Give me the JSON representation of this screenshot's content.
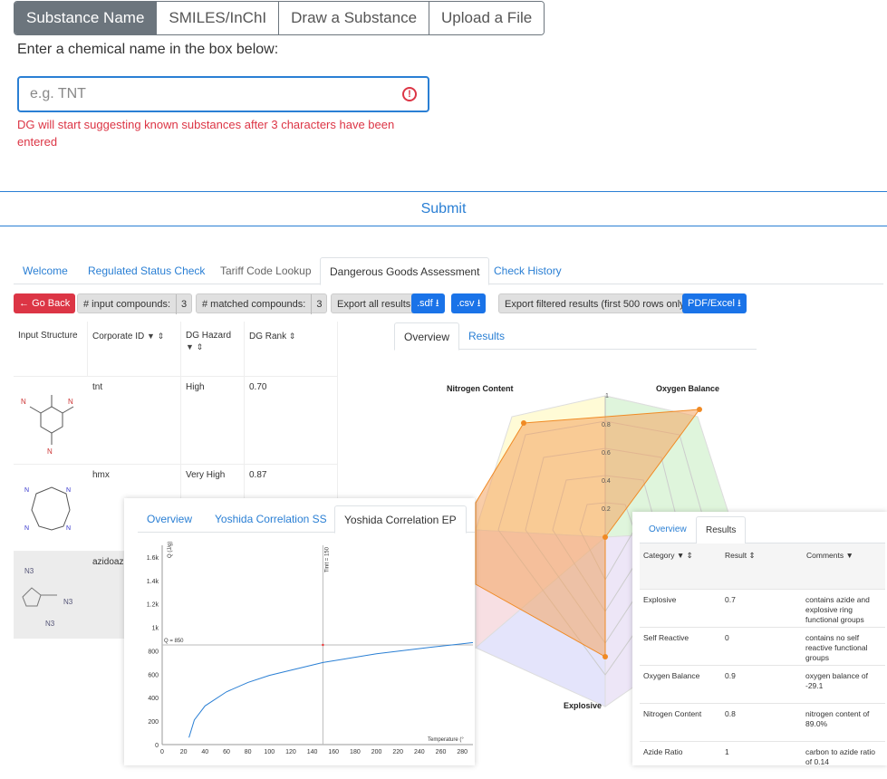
{
  "search_tabs": [
    "Substance Name",
    "SMILES/InChI",
    "Draw a Substance",
    "Upload a File"
  ],
  "prompt": "Enter a chemical name in the box below:",
  "input": {
    "placeholder": "e.g. TNT",
    "value": ""
  },
  "error_message": "DG will start suggesting known substances after 3 characters have been entered",
  "submit_label": "Submit",
  "nav_tabs": [
    "Welcome",
    "Regulated Status Check",
    "Tariff Code Lookup",
    "Dangerous Goods Assessment",
    "Check History"
  ],
  "toolbar": {
    "go_back": "Go Back",
    "input_compounds_label": "# input compounds:",
    "input_compounds_count": "3",
    "matched_compounds_label": "# matched compounds:",
    "matched_compounds_count": "3",
    "export_all_label": "Export all results:",
    "sdf_label": ".sdf",
    "csv_label": ".csv",
    "export_filtered_label": "Export filtered results (first 500 rows only):",
    "pdf_excel_label": "PDF/Excel"
  },
  "grid": {
    "headers": [
      "Input Structure",
      "Corporate ID",
      "DG Hazard",
      "DG Rank"
    ],
    "rows": [
      {
        "id": "tnt",
        "hazard": "High",
        "rank": "0.70"
      },
      {
        "id": "hmx",
        "hazard": "Very High",
        "rank": "0.87"
      },
      {
        "id": "azidoaz",
        "hazard": "",
        "rank": ""
      }
    ]
  },
  "detail_tabs": [
    "Overview",
    "Results"
  ],
  "radar": {
    "labels": [
      "Nitrogen Content",
      "Oxygen Balance",
      "Explosive"
    ],
    "ticks": [
      "1",
      "0.8",
      "0.6",
      "0.4",
      "0.2"
    ]
  },
  "yoshida_tabs": [
    "Overview",
    "Yoshida Correlation SS",
    "Yoshida Correlation EP"
  ],
  "results_tabs": [
    "Overview",
    "Results"
  ],
  "results_table": {
    "headers": [
      "Category",
      "Result",
      "Comments"
    ],
    "rows": [
      {
        "category": "Explosive",
        "result": "0.7",
        "comment": "contains azide and explosive ring functional groups"
      },
      {
        "category": "Self Reactive",
        "result": "0",
        "comment": "contains no self reactive functional groups"
      },
      {
        "category": "Oxygen Balance",
        "result": "0.9",
        "comment": "oxygen balance of -29.1"
      },
      {
        "category": "Nitrogen Content",
        "result": "0.8",
        "comment": "nitrogen content of 89.0%"
      },
      {
        "category": "Azide Ratio",
        "result": "1",
        "comment": "carbon to azide ratio of 0.14"
      }
    ]
  },
  "chart_data": [
    {
      "type": "line",
      "title": "",
      "xlabel": "Temperature (°",
      "ylabel": "Q (J/g)",
      "x_ticks": [
        0,
        20,
        40,
        60,
        80,
        100,
        120,
        140,
        160,
        180,
        200,
        220,
        240,
        260,
        280
      ],
      "y_ticks": [
        "0",
        "200",
        "400",
        "600",
        "800",
        "1k",
        "1.2k",
        "1.4k",
        "1.6k"
      ],
      "xlim": [
        0,
        290
      ],
      "ylim": [
        0,
        1700
      ],
      "series": [
        {
          "x": [
            25,
            30,
            40,
            60,
            80,
            100,
            150,
            200,
            250,
            290
          ],
          "y": [
            60,
            210,
            330,
            450,
            530,
            590,
            700,
            775,
            830,
            870
          ]
        }
      ],
      "annotations": [
        "Tinit = 150",
        "Q = 850"
      ],
      "reference_lines": {
        "x": 150,
        "y": 850
      }
    }
  ],
  "colors": {
    "accent": "#2a7fd4",
    "danger": "#dc3545",
    "segment_active": "#6c757d",
    "radar_fill": "#f4a460"
  }
}
